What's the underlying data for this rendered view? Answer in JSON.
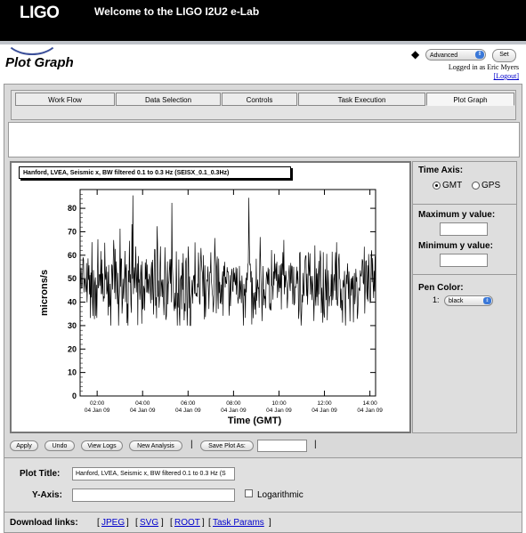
{
  "header": {
    "logo": "LIGO",
    "welcome": "Welcome to the LIGO I2U2 e-Lab"
  },
  "page": {
    "title": "Plot Graph",
    "role_select": "Advanced",
    "set_label": "Set",
    "logged_in": "Logged in as Eric Myers",
    "logout": "[Logout]"
  },
  "tabs": [
    "Work Flow",
    "Data Selection",
    "Controls",
    "Task Execution",
    "Plot Graph"
  ],
  "chart_data": {
    "type": "line",
    "title": "Hanford, LVEA, Seismic x, BW filtered 0.1 to 0.3 Hz (SEISX_0.1_0.3Hz)",
    "xlabel": "Time (GMT)",
    "ylabel": "microns/s",
    "ylim": [
      0,
      88
    ],
    "yticks": [
      0,
      10,
      20,
      30,
      40,
      50,
      60,
      70,
      80
    ],
    "xlim": [
      "01:15",
      "14:15"
    ],
    "xticks": [
      {
        "time": "02:00",
        "date": "04 Jan 09"
      },
      {
        "time": "04:00",
        "date": "04 Jan 09"
      },
      {
        "time": "06:00",
        "date": "04 Jan 09"
      },
      {
        "time": "08:00",
        "date": "04 Jan 09"
      },
      {
        "time": "10:00",
        "date": "04 Jan 09"
      },
      {
        "time": "12:00",
        "date": "04 Jan 09"
      },
      {
        "time": "14:00",
        "date": "04 Jan 09"
      }
    ],
    "series": [
      {
        "color": "#000000",
        "mean": 47,
        "spread": 10,
        "max": 86,
        "min": 30,
        "samples": 600
      }
    ]
  },
  "side": {
    "time_axis_label": "Time Axis:",
    "gmt": "GMT",
    "gps": "GPS",
    "max_y_label": "Maximum y value:",
    "min_y_label": "Minimum y value:",
    "pen_color_label": "Pen Color:",
    "pen_index": "1:",
    "pen_color": "black"
  },
  "buttons": {
    "apply": "Apply",
    "undo": "Undo",
    "view_logs": "View Logs",
    "new_analysis": "New Analysis",
    "save_plot_as": "Save Plot As:"
  },
  "form": {
    "plot_title_label": "Plot Title:",
    "plot_title_value": "Hanford, LVEA, Seismic x, BW filtered 0.1 to 0.3 Hz (S",
    "y_axis_label": "Y-Axis:",
    "y_axis_value": "",
    "logarithmic": "Logarithmic"
  },
  "download": {
    "label": "Download links:",
    "links": [
      "JPEG",
      "SVG",
      "ROOT",
      "Task Params"
    ]
  }
}
